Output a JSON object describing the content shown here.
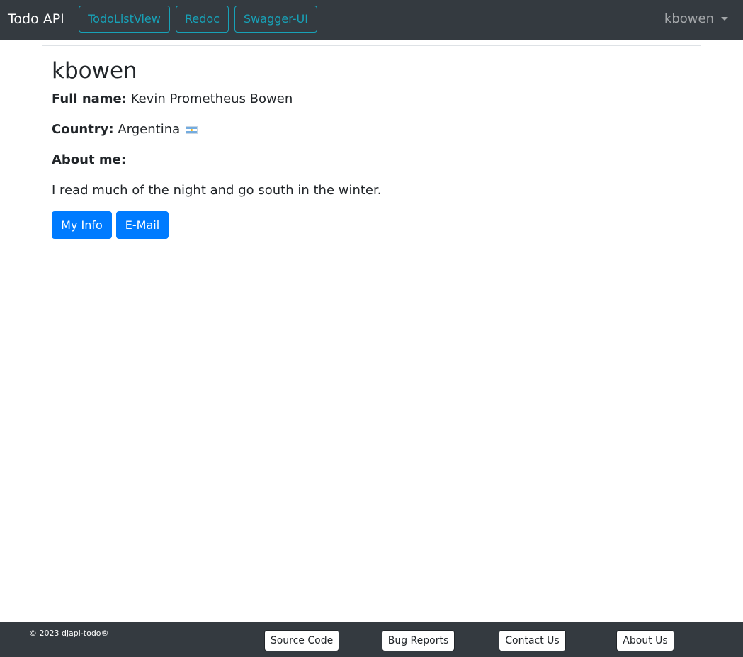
{
  "navbar": {
    "brand": "Todo API",
    "buttons": [
      {
        "label": "TodoListView"
      },
      {
        "label": "Redoc"
      },
      {
        "label": "Swagger-UI"
      }
    ],
    "user_menu": "kbowen",
    "accent_color": "#17a2b8",
    "background_color": "#343a40"
  },
  "profile": {
    "username": "kbowen",
    "full_name_label": "Full name:",
    "full_name": "Kevin Prometheus Bowen",
    "country_label": "Country:",
    "country": "Argentina",
    "country_flag_icon": "argentina-flag-icon",
    "about_label": "About me:",
    "about_text": "I read much of the night and go south in the winter.",
    "buttons": {
      "my_info": "My Info",
      "email": "E-Mail"
    },
    "primary_color": "#007bff"
  },
  "footer": {
    "copyright": "© 2023 djapi-todo®",
    "links": [
      {
        "label": "Source Code"
      },
      {
        "label": "Bug Reports"
      },
      {
        "label": "Contact Us"
      },
      {
        "label": "About Us"
      }
    ]
  }
}
